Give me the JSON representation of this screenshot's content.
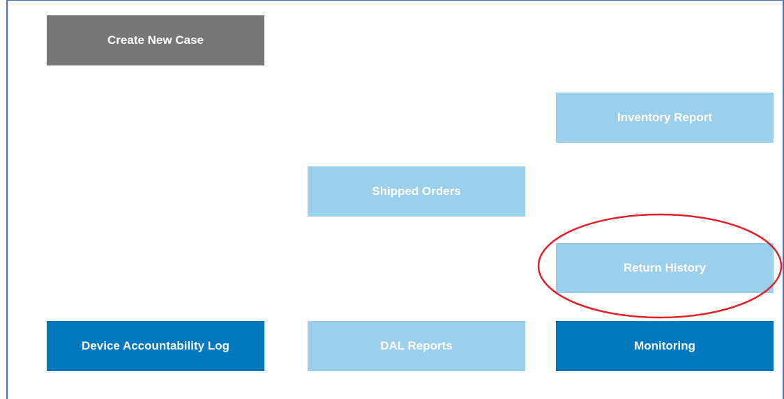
{
  "tiles": {
    "create_new_case": "Create New Case",
    "inventory_report": "Inventory Report",
    "shipped_orders": "Shipped Orders",
    "return_history": "Return History",
    "device_accountability_log": "Device Accountability Log",
    "dal_reports": "DAL Reports",
    "monitoring": "Monitoring"
  },
  "colors": {
    "gray_tile": "#767676",
    "light_tile": "#9bcfeb",
    "dark_tile": "#0078be",
    "highlight_ellipse": "#e0202a",
    "frame": "#4472c4"
  }
}
